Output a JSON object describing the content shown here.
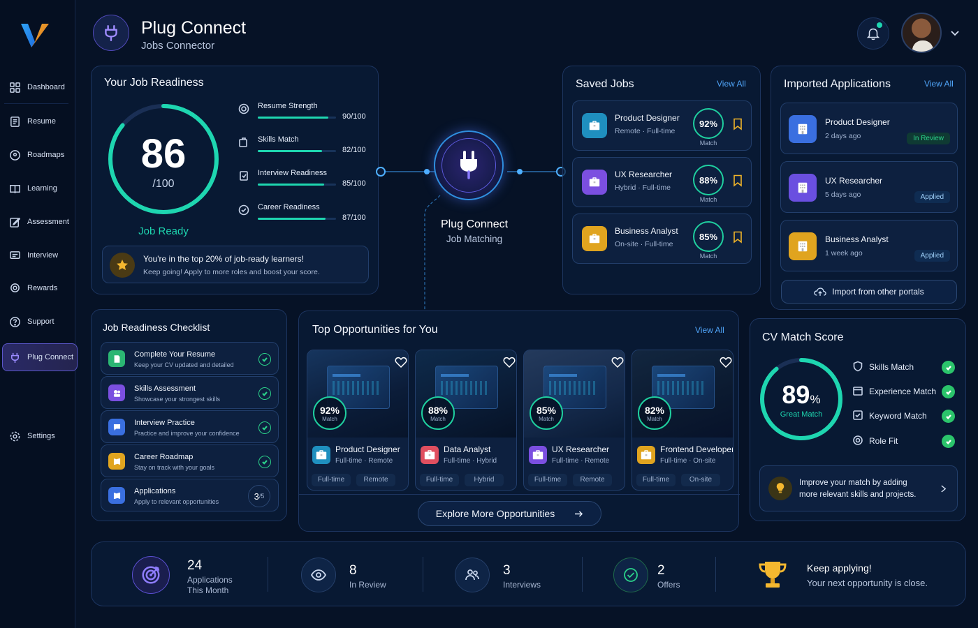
{
  "app": {
    "title": "Plug Connect",
    "subtitle": "Jobs Connector"
  },
  "sidebar": {
    "items": [
      {
        "label": "Dashboard",
        "icon": "grid-icon"
      },
      {
        "label": "Resume",
        "icon": "document-icon"
      },
      {
        "label": "Roadmaps",
        "icon": "map-pin-icon"
      },
      {
        "label": "Learning",
        "icon": "book-icon"
      },
      {
        "label": "Assessment",
        "icon": "edit-icon"
      },
      {
        "label": "Interview",
        "icon": "chat-icon"
      },
      {
        "label": "Rewards",
        "icon": "award-icon"
      },
      {
        "label": "Support",
        "icon": "help-icon"
      },
      {
        "label": "Plug Connect",
        "icon": "plug-icon"
      },
      {
        "label": "Settings",
        "icon": "gear-icon"
      }
    ]
  },
  "readiness": {
    "title": "Your Job Readiness",
    "score": "86",
    "score_of": "/100",
    "score_value": 86,
    "status": "Job Ready",
    "metrics": [
      {
        "label": "Resume Strength",
        "value": "90/100",
        "pct": 90
      },
      {
        "label": "Skills Match",
        "value": "82/100",
        "pct": 82
      },
      {
        "label": "Interview Readiness",
        "value": "85/100",
        "pct": 85
      },
      {
        "label": "Career Readiness",
        "value": "87/100",
        "pct": 87
      }
    ],
    "banner_title": "You're in the top 20% of job-ready learners!",
    "banner_sub": "Keep going! Apply to more roles and boost your score."
  },
  "hub": {
    "title": "Plug Connect",
    "subtitle": "Job Matching"
  },
  "saved_jobs": {
    "title": "Saved Jobs",
    "view_all": "View All",
    "items": [
      {
        "title": "Product Designer",
        "meta": "Remote · Full-time",
        "match": "92%",
        "match_label": "Match",
        "color": "#1f8fbf"
      },
      {
        "title": "UX Researcher",
        "meta": "Hybrid · Full-time",
        "match": "88%",
        "match_label": "Match",
        "color": "#7b4fe0"
      },
      {
        "title": "Business Analyst",
        "meta": "On-site · Full-time",
        "match": "85%",
        "match_label": "Match",
        "color": "#e0a41f"
      }
    ]
  },
  "imported": {
    "title": "Imported Applications",
    "view_all": "View All",
    "items": [
      {
        "title": "Product Designer",
        "meta": "2 days ago",
        "status": "In Review",
        "color": "#3a6fe0"
      },
      {
        "title": "UX Researcher",
        "meta": "5 days ago",
        "status": "Applied",
        "color": "#6a4fe0"
      },
      {
        "title": "Business Analyst",
        "meta": "1 week ago",
        "status": "Applied",
        "color": "#e0a41f"
      }
    ],
    "import_label": "Import from other portals"
  },
  "checklist": {
    "title": "Job Readiness Checklist",
    "items": [
      {
        "title": "Complete Your Resume",
        "sub": "Keep your CV updated and detailed",
        "color": "#2bb673"
      },
      {
        "title": "Skills Assessment",
        "sub": "Showcase your strongest skills",
        "color": "#7b4fe0"
      },
      {
        "title": "Interview Practice",
        "sub": "Practice and improve your confidence",
        "color": "#3a6fe0"
      },
      {
        "title": "Career Roadmap",
        "sub": "Stay on track with your goals",
        "color": "#e0a41f"
      },
      {
        "title": "Applications",
        "sub": "Apply to relevant opportunities",
        "color": "#3a6fe0",
        "progress": "3",
        "progress_of": "/5"
      }
    ]
  },
  "opportunities": {
    "title": "Top Opportunities for You",
    "view_all": "View All",
    "items": [
      {
        "title": "Product Designer",
        "meta": "Full-time · Remote",
        "match": "92%",
        "match_label": "Match",
        "tags": [
          "Full-time",
          "Remote"
        ],
        "color": "#1f8fbf"
      },
      {
        "title": "Data Analyst",
        "meta": "Full-time · Hybrid",
        "match": "88%",
        "match_label": "Match",
        "tags": [
          "Full-time",
          "Hybrid"
        ],
        "color": "#e04f5f"
      },
      {
        "title": "UX Researcher",
        "meta": "Full-time · Remote",
        "match": "85%",
        "match_label": "Match",
        "tags": [
          "Full-time",
          "Remote"
        ],
        "color": "#7b4fe0"
      },
      {
        "title": "Frontend Developer",
        "meta": "Full-time · On-site",
        "match": "82%",
        "match_label": "Match",
        "tags": [
          "Full-time",
          "On-site"
        ],
        "color": "#e0a41f"
      }
    ],
    "explore_label": "Explore More Opportunities"
  },
  "cv_match": {
    "title": "CV Match Score",
    "score": "89",
    "unit": "%",
    "score_value": 89,
    "label": "Great Match",
    "items": [
      {
        "label": "Skills Match",
        "icon": "shield-icon"
      },
      {
        "label": "Experience Match",
        "icon": "calendar-icon"
      },
      {
        "label": "Keyword Match",
        "icon": "check-square-icon"
      },
      {
        "label": "Role Fit",
        "icon": "target-icon"
      }
    ],
    "tip": "Improve your match by adding more relevant skills and projects."
  },
  "stats": [
    {
      "value": "24",
      "label": "Applications This Month",
      "icon": "target-icon"
    },
    {
      "value": "8",
      "label": "In Review",
      "icon": "eye-icon"
    },
    {
      "value": "3",
      "label": "Interviews",
      "icon": "users-icon"
    },
    {
      "value": "2",
      "label": "Offers",
      "icon": "check-circle-icon"
    }
  ],
  "motivation": {
    "title": "Keep applying!",
    "sub": "Your next opportunity is close."
  },
  "colors": {
    "accent": "#1ed6b0",
    "brand": "#6c5ce7",
    "link": "#4fa3f7",
    "background": "#061226"
  }
}
